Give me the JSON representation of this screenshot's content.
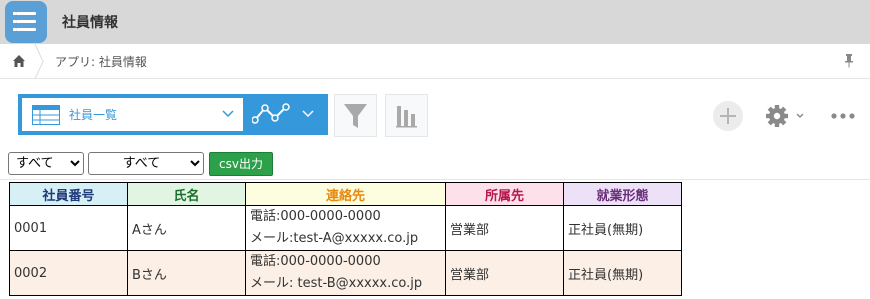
{
  "app": {
    "title": "社員情報"
  },
  "breadcrumb": {
    "text": "アプリ: 社員情報"
  },
  "view": {
    "selected": "社員一覧"
  },
  "filters": {
    "select1": "すべて",
    "select2": "すべて",
    "csv_label": "csv出力"
  },
  "table": {
    "columns": [
      "社員番号",
      "氏名",
      "連絡先",
      "所属先",
      "就業形態"
    ],
    "column_colors": [
      "#d6f0f6",
      "#e2f5e2",
      "#fdfde0",
      "#fde0ea",
      "#ece1f7"
    ],
    "header_text_colors": [
      "#1f3b7a",
      "#1a6e2e",
      "#e8890c",
      "#b6184f",
      "#6b2f7a"
    ],
    "rows": [
      {
        "id": "0001",
        "name": "Aさん",
        "phone": "電話:000-0000-0000",
        "mail": "メール:test-A@xxxxx.co.jp",
        "dept": "営業部",
        "type": "正社員(無期)"
      },
      {
        "id": "0002",
        "name": "Bさん",
        "phone": "電話:000-0000-0000",
        "mail": "メール: test-B@xxxxx.co.jp",
        "dept": "営業部",
        "type": "正社員(無期)"
      }
    ]
  },
  "icons": {
    "app": "list-app-icon",
    "home": "home-icon",
    "pin": "pin-icon",
    "view": "list-view-icon",
    "graph": "graph-icon",
    "filter": "funnel-icon",
    "chart": "bar-chart-icon",
    "add": "plus-icon",
    "settings": "gear-icon",
    "more": "more-dots-icon"
  },
  "colors": {
    "accent": "#3498db",
    "csv": "#2da14a",
    "titlebar": "#d8d8d8"
  }
}
